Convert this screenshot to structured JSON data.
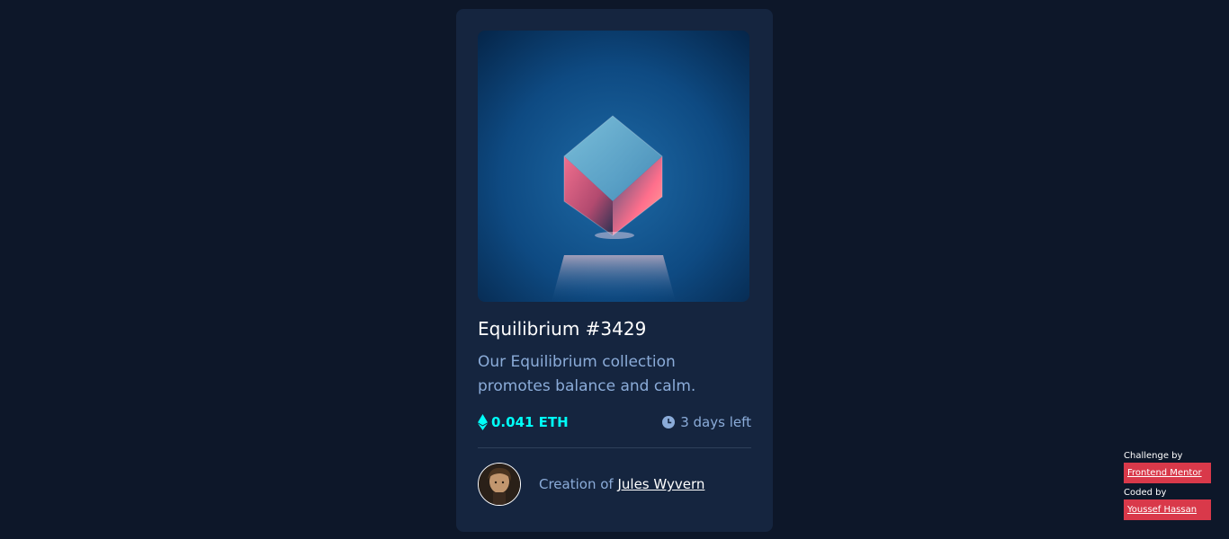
{
  "card": {
    "image_alt": "Equilibrium cube",
    "title": "Equilibrium #3429",
    "description": "Our Equilibrium collection promotes balance and calm.",
    "price": "0.041 ETH",
    "price_icon": "ethereum-icon",
    "time_left": "3 days left",
    "time_icon": "clock-icon",
    "creator_prefix": "Creation of",
    "creator_name": "Jules Wyvern"
  },
  "attribution": {
    "challenge_label": "Challenge by",
    "challenge_link": "Frontend Mentor",
    "coded_label": "Coded by",
    "coded_link": "Youssef Hassan"
  },
  "colors": {
    "page_bg": "#0d1729",
    "card_bg": "#15253f",
    "accent_cyan": "#00fff8",
    "soft_blue": "#8bacd9",
    "attribution_red": "#d9394a"
  }
}
